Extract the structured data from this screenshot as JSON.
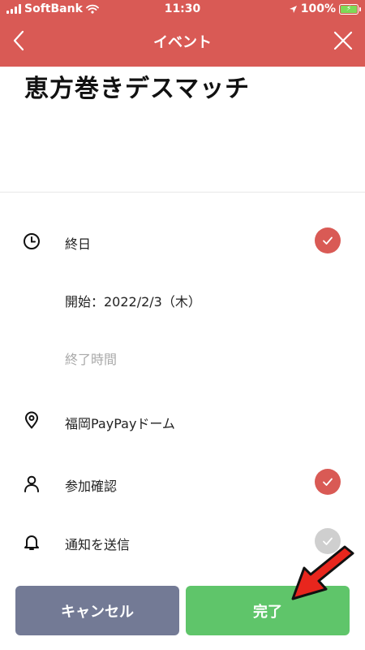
{
  "status_bar": {
    "carrier": "SoftBank",
    "time": "11:30",
    "battery": "100%"
  },
  "nav": {
    "title": "イベント"
  },
  "event": {
    "title": "恵方巻きデスマッチ"
  },
  "details": {
    "all_day_label": "終日",
    "all_day_checked": true,
    "start_label": "開始：2022/2/3（木）",
    "end_placeholder": "終了時間",
    "location": "福岡PayPayドーム",
    "rsvp_label": "参加確認",
    "rsvp_checked": true,
    "notify_label": "通知を送信",
    "notify_checked": false
  },
  "footer": {
    "cancel_label": "キャンセル",
    "done_label": "完了"
  },
  "colors": {
    "header": "#d95a55",
    "check": "#d95a55",
    "cancel": "#737a95",
    "done": "#5fc56a",
    "annotation_arrow": "#e8261d"
  }
}
